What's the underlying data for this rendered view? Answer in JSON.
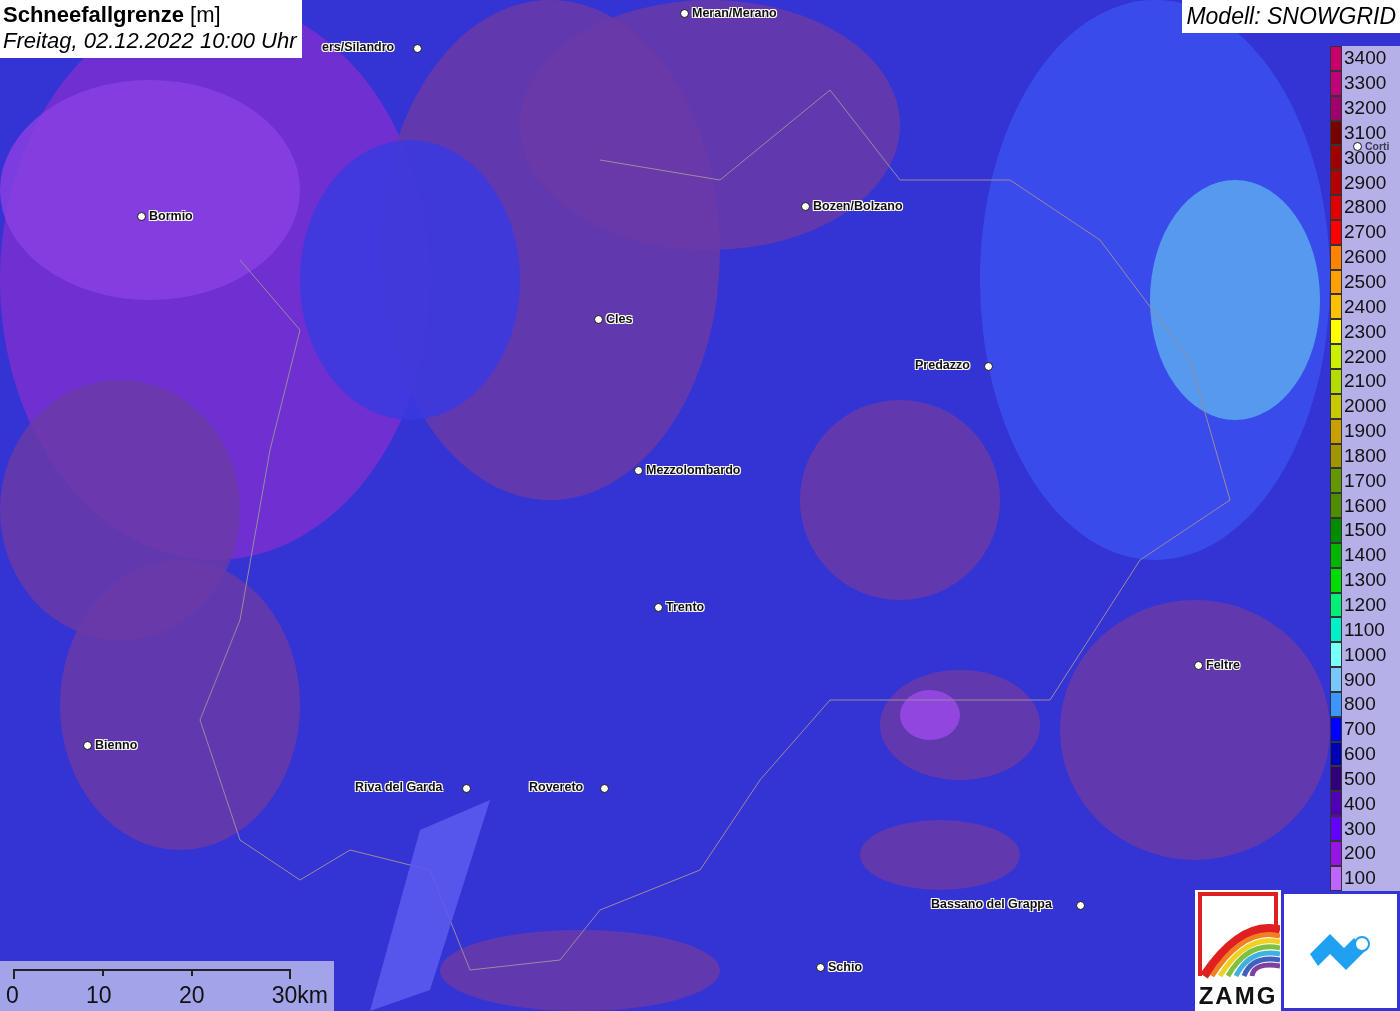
{
  "title": {
    "main": "Schneefallgrenze",
    "unit": "[m]",
    "subtitle": "Freitag, 02.12.2022 10:00 Uhr"
  },
  "model": "Modell: SNOWGRID",
  "cities": [
    {
      "name": "Meran/Merano",
      "kind": "town"
    },
    {
      "name": "ers/Silandro",
      "kind": "town"
    },
    {
      "name": "Bormio",
      "kind": "town"
    },
    {
      "name": "Bozen/Bolzano",
      "kind": "town"
    },
    {
      "name": "Cles",
      "kind": "town"
    },
    {
      "name": "Predazzo",
      "kind": "town"
    },
    {
      "name": "Mezzolombardo",
      "kind": "town"
    },
    {
      "name": "Trento",
      "kind": "town"
    },
    {
      "name": "Feltre",
      "kind": "town"
    },
    {
      "name": "Bienno",
      "kind": "town"
    },
    {
      "name": "Riva del Garda",
      "kind": "town"
    },
    {
      "name": "Rovereto",
      "kind": "town"
    },
    {
      "name": "Bassano del Grappa",
      "kind": "town"
    },
    {
      "name": "Schio",
      "kind": "town"
    },
    {
      "name": "Corti",
      "kind": "faded"
    }
  ],
  "legend": [
    {
      "label": "3400",
      "color": "#c8006e"
    },
    {
      "label": "3300",
      "color": "#c0007a"
    },
    {
      "label": "3200",
      "color": "#a0006e"
    },
    {
      "label": "3100",
      "color": "#780000"
    },
    {
      "label": "3000",
      "color": "#a00000"
    },
    {
      "label": "2900",
      "color": "#b40000"
    },
    {
      "label": "2800",
      "color": "#dc0000"
    },
    {
      "label": "2700",
      "color": "#ff0000"
    },
    {
      "label": "2600",
      "color": "#ff8200"
    },
    {
      "label": "2500",
      "color": "#ffa000"
    },
    {
      "label": "2400",
      "color": "#ffbe00"
    },
    {
      "label": "2300",
      "color": "#ffff00"
    },
    {
      "label": "2200",
      "color": "#c8f000"
    },
    {
      "label": "2100",
      "color": "#b4dc00"
    },
    {
      "label": "2000",
      "color": "#c8c800"
    },
    {
      "label": "1900",
      "color": "#c8a000"
    },
    {
      "label": "1800",
      "color": "#a09600"
    },
    {
      "label": "1700",
      "color": "#649600"
    },
    {
      "label": "1600",
      "color": "#508c00"
    },
    {
      "label": "1500",
      "color": "#008c00"
    },
    {
      "label": "1400",
      "color": "#00b400"
    },
    {
      "label": "1300",
      "color": "#00dc00"
    },
    {
      "label": "1200",
      "color": "#00f078"
    },
    {
      "label": "1100",
      "color": "#00f0c8"
    },
    {
      "label": "1000",
      "color": "#78ffff"
    },
    {
      "label": "900",
      "color": "#78c8ff"
    },
    {
      "label": "800",
      "color": "#3c96ff"
    },
    {
      "label": "700",
      "color": "#0000ff"
    },
    {
      "label": "600",
      "color": "#0000b4"
    },
    {
      "label": "500",
      "color": "#320078"
    },
    {
      "label": "400",
      "color": "#5000b4"
    },
    {
      "label": "300",
      "color": "#6400ff"
    },
    {
      "label": "200",
      "color": "#9614e6"
    },
    {
      "label": "100",
      "color": "#be64ff"
    }
  ],
  "scale": [
    "0",
    "10",
    "20",
    "30km"
  ],
  "logo_text": "ZAMG"
}
